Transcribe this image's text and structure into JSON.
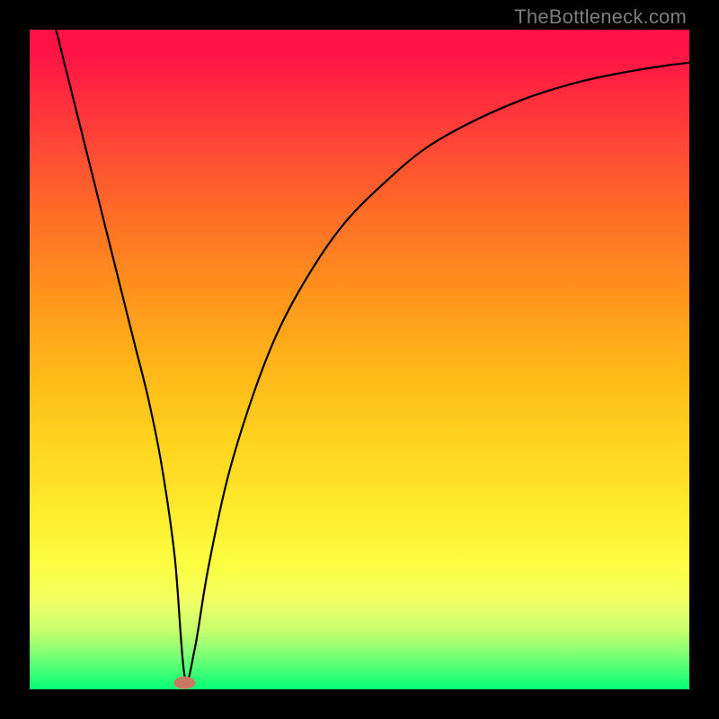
{
  "watermark": "TheBottleneck.com",
  "chart_data": {
    "type": "line",
    "title": "",
    "xlabel": "",
    "ylabel": "",
    "xlim": [
      0,
      100
    ],
    "ylim": [
      0,
      100
    ],
    "grid": false,
    "legend": false,
    "series": [
      {
        "name": "bottleneck-curve",
        "x": [
          4,
          6,
          8,
          10,
          12,
          14,
          16,
          18,
          20,
          22,
          23.5,
          25,
          27,
          30,
          34,
          38,
          43,
          48,
          54,
          60,
          67,
          75,
          83,
          90,
          96,
          100
        ],
        "values": [
          100,
          92,
          84,
          76,
          68,
          60,
          52,
          44,
          34,
          20,
          2,
          6,
          18,
          32,
          45,
          55,
          64,
          71,
          77,
          82,
          86,
          89.5,
          92,
          93.5,
          94.5,
          95
        ]
      }
    ],
    "marker": {
      "name": "min-point",
      "x": 23.5,
      "y": 1,
      "color": "#c97963"
    },
    "gradient_stops": [
      {
        "pos": 0,
        "color": "#ff1245"
      },
      {
        "pos": 14,
        "color": "#ff3b3a"
      },
      {
        "pos": 27,
        "color": "#ff6a28"
      },
      {
        "pos": 38,
        "color": "#ff8d1d"
      },
      {
        "pos": 50,
        "color": "#ffb319"
      },
      {
        "pos": 62,
        "color": "#ffd21e"
      },
      {
        "pos": 74,
        "color": "#ffee2e"
      },
      {
        "pos": 82,
        "color": "#fbff45"
      },
      {
        "pos": 87,
        "color": "#efff66"
      },
      {
        "pos": 91,
        "color": "#c7ff6e"
      },
      {
        "pos": 94,
        "color": "#8dff74"
      },
      {
        "pos": 97,
        "color": "#4bff76"
      },
      {
        "pos": 100,
        "color": "#0cff78"
      }
    ]
  }
}
